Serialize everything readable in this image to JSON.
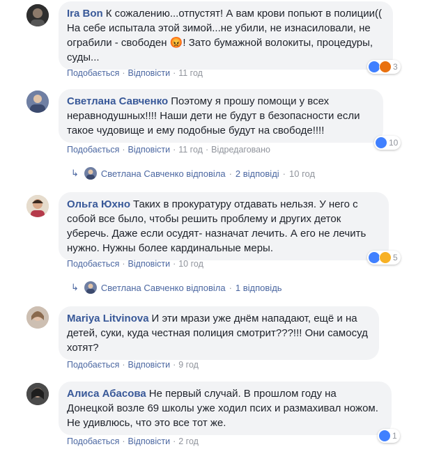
{
  "comments": [
    {
      "author": "Ira Bon",
      "text": "К сожалению...отпустят! А вам крови попьют в полиции(( На себе испытала этой зимой...не убили, не изнасиловали, не ограбили - свободен 😡! Зато бумажной волокиты, процедуры, суды...",
      "like": "Подобається",
      "reply": "Відповісти",
      "time": "11 год",
      "reaction_count": "3",
      "reactions": [
        "like-icon",
        "angry-icon"
      ]
    },
    {
      "author": "Светлана Савченко",
      "text": "Поэтому я прошу помощи у всех неравнодушных!!!! Наши дети не будут в безопасности если такое чудовище и ему подобные будут на свободе!!!!",
      "like": "Подобається",
      "reply": "Відповісти",
      "time": "11 год",
      "edited": "Відредаговано",
      "reaction_count": "10",
      "reactions": [
        "like-icon"
      ],
      "replies": {
        "name": "Светлана Савченко відповіла",
        "count": "2 відповіді",
        "time": "10 год"
      }
    },
    {
      "author": "Ольга Юхно",
      "text": "Таких в прокуратуру отдавать нельзя. У него с собой все было, чтобы решить проблему и других деток уберечь. Даже если осудят- назначат лечить. А его не лечить нужно. Нужны более кардинальные меры.",
      "like": "Подобається",
      "reply": "Відповісти",
      "time": "10 год",
      "reaction_count": "5",
      "reactions": [
        "like-icon",
        "sad-icon"
      ],
      "replies": {
        "name": "Светлана Савченко відповіла",
        "count": "1 відповідь"
      }
    },
    {
      "author": "Mariya Litvinova",
      "text": "И эти мрази уже днём нападают, ещё и на детей, суки, куда честная полиция смотрит???!!! Они самосуд хотят?",
      "like": "Подобається",
      "reply": "Відповісти",
      "time": "9 год"
    },
    {
      "author": "Алиса Абасова",
      "text": "Не первый случай. В прошлом году на Донецкой возле 69 школы уже ходил псих и размахивал ножом. Не удивлюсь, что это все тот же.",
      "like": "Подобається",
      "reply": "Відповісти",
      "time": "2 год",
      "reaction_count": "1",
      "reactions": [
        "like-icon"
      ]
    }
  ],
  "colors": {
    "link": "#385898",
    "meta": "#90949c",
    "bubble": "#f2f3f5",
    "like": "#4080ff"
  }
}
